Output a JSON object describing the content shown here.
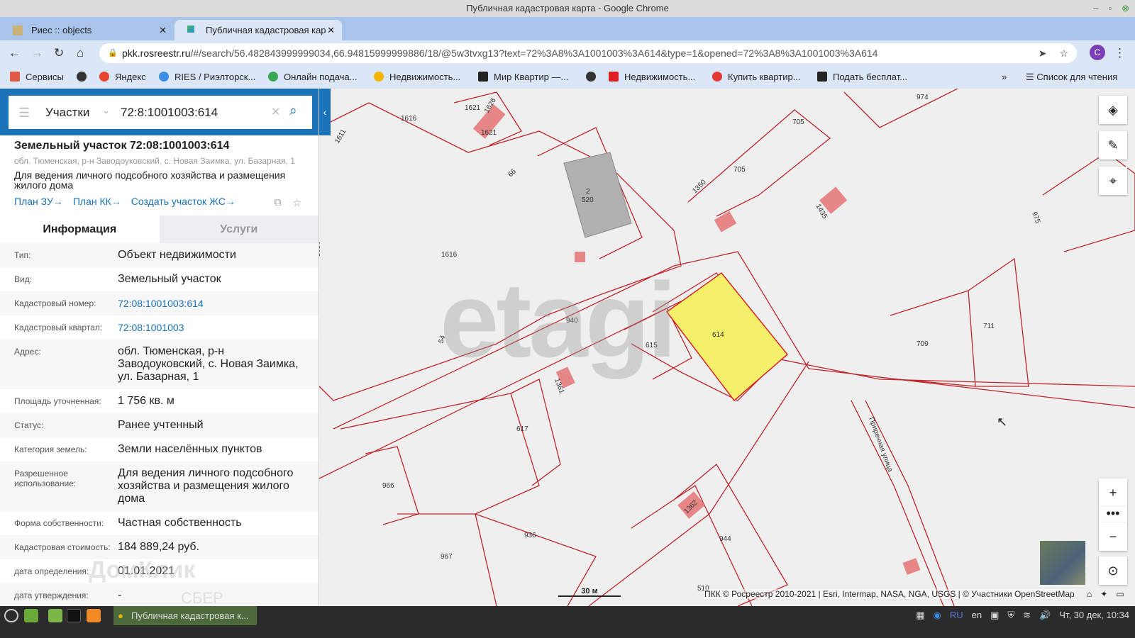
{
  "window": {
    "title": "Публичная кадастровая карта - Google Chrome"
  },
  "tabs": [
    {
      "label": "Риес :: objects"
    },
    {
      "label": "Публичная кадастровая кар"
    }
  ],
  "url": {
    "host": "pkk.rosreestr.ru",
    "path": "/#/search/56.482843999999034,66.94815999999886/18/@5w3tvxg13?text=72%3A8%3A1001003%3A614&type=1&opened=72%3A8%3A1001003%3A614"
  },
  "profile_initial": "C",
  "bookmarks": [
    {
      "label": "Сервисы",
      "color": "#e05a47"
    },
    {
      "label": "",
      "color": "#333"
    },
    {
      "label": "Яндекс",
      "color": "#e8452c"
    },
    {
      "label": "RIES / Риэлторск...",
      "color": "#3a8ee6"
    },
    {
      "label": "Онлайн подача...",
      "color": "#3aa757"
    },
    {
      "label": "Недвижимость...",
      "color": "#f2b600"
    },
    {
      "label": "Мир Квартир —...",
      "color": "#222"
    },
    {
      "label": "",
      "color": "#333"
    },
    {
      "label": "Недвижимость...",
      "color": "#e02020"
    },
    {
      "label": "Купить квартир...",
      "color": "#e53935"
    },
    {
      "label": "Подать бесплат...",
      "color": "#222"
    }
  ],
  "reading_list": "Список для чтения",
  "search": {
    "type": "Участки",
    "query": "72:8:1001003:614"
  },
  "card": {
    "title": "Земельный участок 72:08:1001003:614",
    "address": "обл. Тюменская, р-н Заводоуковский, с. Новая Заимка, ул. Базарная, 1",
    "use": "Для ведения личного подсобного хозяйства и размещения жилого дома",
    "links": [
      "План ЗУ→",
      "План КК→",
      "Создать участок ЖС→"
    ]
  },
  "info_tabs": {
    "active": "Информация",
    "other": "Услуги"
  },
  "fields": [
    {
      "k": "Тип:",
      "v": "Объект недвижимости"
    },
    {
      "k": "Вид:",
      "v": "Земельный участок"
    },
    {
      "k": "Кадастровый номер:",
      "v": "72:08:1001003:614",
      "link": true
    },
    {
      "k": "Кадастровый квартал:",
      "v": "72:08:1001003",
      "link": true
    },
    {
      "k": "Адрес:",
      "v": "обл. Тюменская, р-н Заводоуковский, с. Новая Заимка, ул. Базарная, 1"
    },
    {
      "k": "Площадь уточненная:",
      "v": "1 756 кв. м"
    },
    {
      "k": "Статус:",
      "v": "Ранее учтенный"
    },
    {
      "k": "Категория земель:",
      "v": "Земли населённых пунктов"
    },
    {
      "k": "Разрешенное использование:",
      "v": "Для ведения личного подсобного хозяйства и размещения жилого дома"
    },
    {
      "k": "Форма собственности:",
      "v": "Частная собственность"
    },
    {
      "k": "Кадастровая стоимость:",
      "v": "184 889,24 руб."
    },
    {
      "k": "дата определения:",
      "v": "01.01.2021"
    },
    {
      "k": "дата утверждения:",
      "v": "-"
    }
  ],
  "map": {
    "selected_color": "#f5f06a",
    "parcel_labels": [
      "1621",
      "1626",
      "1621",
      "1616",
      "1611",
      "974",
      "705",
      "705",
      "1350",
      "1435",
      "975",
      "520",
      "2",
      "1616",
      "1616",
      "66",
      "940",
      "54",
      "615",
      "614",
      "1361",
      "617",
      "709",
      "711",
      "966",
      "936",
      "967",
      "944",
      "1362",
      "510"
    ],
    "street": "Приречная улица",
    "scale": "30 м",
    "attribution": "ПКК © Росреестр 2010-2021 | Esri, Intermap, NASA, NGA, USGS | © Участники OpenStreetMap",
    "watermark": "etagi",
    "watermark2": "ДомКлик",
    "watermark3": "СБЕР"
  },
  "taskbar": {
    "task": "Публичная кадастровая к...",
    "lang1": "RU",
    "lang2": "en",
    "clock": "Чт, 30 дек, 10:34"
  }
}
